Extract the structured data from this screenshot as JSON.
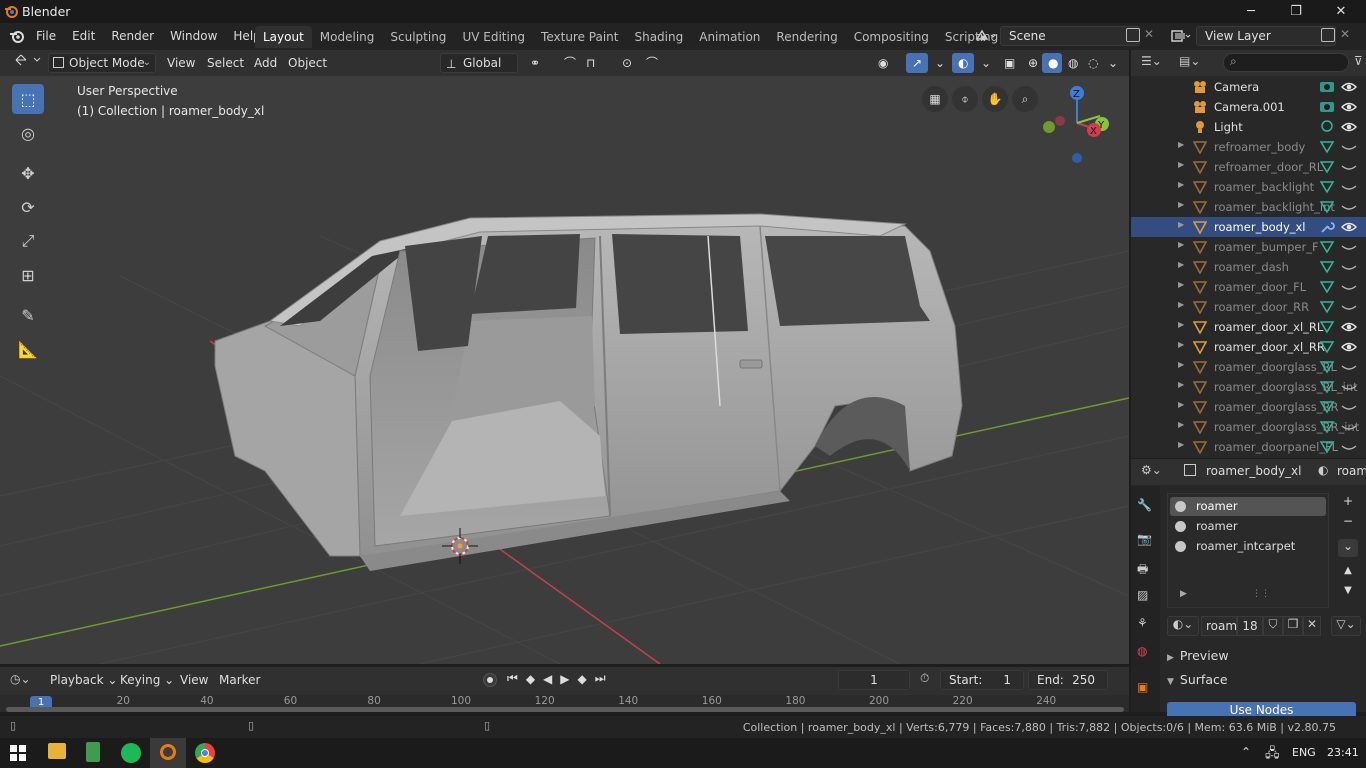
{
  "window": {
    "title": "Blender",
    "controls": {
      "minimize": "─",
      "maximize": "❐",
      "close": "✕"
    }
  },
  "menus": [
    "File",
    "Edit",
    "Render",
    "Window",
    "Help"
  ],
  "workspaces": [
    "Layout",
    "Modeling",
    "Sculpting",
    "UV Editing",
    "Texture Paint",
    "Shading",
    "Animation",
    "Rendering",
    "Compositing",
    "Scripting"
  ],
  "active_workspace": "Layout",
  "add_workspace": "+",
  "scene": {
    "name": "Scene",
    "view_layer": "View Layer"
  },
  "viewport_header": {
    "mode": "Object Mode",
    "menus": [
      "View",
      "Select",
      "Add",
      "Object"
    ],
    "orientation": "Global"
  },
  "viewport": {
    "perspective_label": "User Perspective",
    "collection_label": "(1) Collection | roamer_body_xl",
    "gizmo": {
      "z": "Z",
      "y": "Y",
      "x": "X"
    }
  },
  "outliner": {
    "search_placeholder": "",
    "items": [
      {
        "label": "Camera",
        "type": "camera",
        "visible": true,
        "selected": false,
        "dim": false
      },
      {
        "label": "Camera.001",
        "type": "camera",
        "visible": true,
        "selected": false,
        "dim": false
      },
      {
        "label": "Light",
        "type": "light",
        "visible": true,
        "selected": false,
        "dim": false
      },
      {
        "label": "refroamer_body",
        "type": "mesh",
        "visible": false,
        "selected": false,
        "dim": true
      },
      {
        "label": "refroamer_door_RL",
        "type": "mesh",
        "visible": false,
        "selected": false,
        "dim": true
      },
      {
        "label": "roamer_backlight",
        "type": "mesh",
        "visible": false,
        "selected": false,
        "dim": true
      },
      {
        "label": "roamer_backlight_int",
        "type": "mesh",
        "visible": false,
        "selected": false,
        "dim": true
      },
      {
        "label": "roamer_body_xl",
        "type": "mesh",
        "visible": true,
        "selected": true,
        "dim": false
      },
      {
        "label": "roamer_bumper_F",
        "type": "mesh",
        "visible": false,
        "selected": false,
        "dim": true
      },
      {
        "label": "roamer_dash",
        "type": "mesh",
        "visible": false,
        "selected": false,
        "dim": true
      },
      {
        "label": "roamer_door_FL",
        "type": "mesh",
        "visible": false,
        "selected": false,
        "dim": true
      },
      {
        "label": "roamer_door_RR",
        "type": "mesh",
        "visible": false,
        "selected": false,
        "dim": true
      },
      {
        "label": "roamer_door_xl_RL",
        "type": "mesh",
        "visible": true,
        "selected": false,
        "dim": false
      },
      {
        "label": "roamer_door_xl_RR",
        "type": "mesh",
        "visible": true,
        "selected": false,
        "dim": false
      },
      {
        "label": "roamer_doorglass_RL",
        "type": "mesh",
        "visible": false,
        "selected": false,
        "dim": true
      },
      {
        "label": "roamer_doorglass_RL_int",
        "type": "mesh",
        "visible": false,
        "selected": false,
        "dim": true
      },
      {
        "label": "roamer_doorglass_RR",
        "type": "mesh",
        "visible": false,
        "selected": false,
        "dim": true
      },
      {
        "label": "roamer_doorglass_RR_int",
        "type": "mesh",
        "visible": false,
        "selected": false,
        "dim": true
      },
      {
        "label": "roamer_doorpanel_FL",
        "type": "mesh",
        "visible": false,
        "selected": false,
        "dim": true
      }
    ]
  },
  "properties": {
    "object_name": "roamer_body_xl",
    "material_short": "roam",
    "materials": [
      "roamer",
      "roamer",
      "roamer_intcarpet"
    ],
    "material_field": "roam",
    "user_count": "18",
    "sections": {
      "preview": "Preview",
      "surface": "Surface"
    },
    "use_nodes": "Use Nodes"
  },
  "timeline": {
    "menus": [
      "Playback",
      "Keying",
      "View",
      "Marker"
    ],
    "current_frame": "1",
    "start_label": "Start:",
    "start": "1",
    "end_label": "End:",
    "end": "250",
    "ruler": [
      "1",
      "20",
      "40",
      "60",
      "80",
      "100",
      "120",
      "140",
      "160",
      "180",
      "200",
      "220",
      "240"
    ]
  },
  "statusbar": {
    "info": "Collection | roamer_body_xl | Verts:6,779 | Faces:7,880 | Tris:7,882 | Objects:0/6 | Mem: 63.6 MiB | v2.80.75"
  },
  "taskbar": {
    "language": "ENG",
    "time": "23:41"
  },
  "colors": {
    "accent": "#4772b3",
    "selected_row": "#334d80",
    "x_axis": "#d13d4f",
    "y_axis": "#8bc43a",
    "z_axis": "#3b7fd9"
  }
}
